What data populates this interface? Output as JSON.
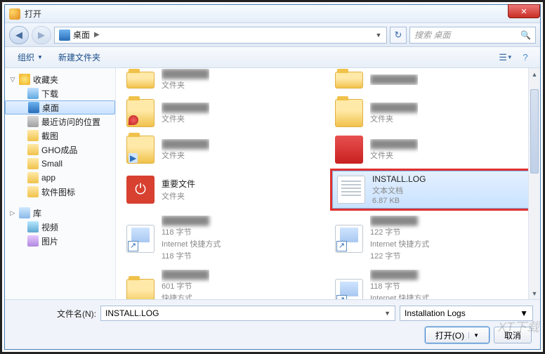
{
  "title": "打开",
  "breadcrumb": {
    "location": "桌面"
  },
  "search": {
    "placeholder": "搜索 桌面"
  },
  "toolbar": {
    "organize": "组织",
    "new_folder": "新建文件夹"
  },
  "sidebar": {
    "favorites": {
      "label": "收藏夹",
      "items": [
        {
          "label": "下载"
        },
        {
          "label": "桌面",
          "selected": true
        },
        {
          "label": "最近访问的位置"
        },
        {
          "label": "截图"
        },
        {
          "label": "GHO成品"
        },
        {
          "label": "Small"
        },
        {
          "label": "app"
        },
        {
          "label": "软件图标"
        }
      ]
    },
    "libraries": {
      "label": "库",
      "items": [
        {
          "label": "视频"
        },
        {
          "label": "图片"
        }
      ]
    }
  },
  "files": [
    {
      "name": "",
      "type": "文件夹",
      "icon": "folder",
      "col": 0,
      "blur": true
    },
    {
      "name": "",
      "type": "",
      "icon": "folder",
      "col": 1,
      "blur": true
    },
    {
      "name": "",
      "type": "文件夹",
      "icon": "folder-shield",
      "col": 0,
      "blur": true
    },
    {
      "name": "",
      "type": "文件夹",
      "icon": "folder",
      "col": 1,
      "blur": true
    },
    {
      "name": "",
      "type": "文件夹",
      "icon": "folder-arrow",
      "col": 0,
      "blur": true
    },
    {
      "name": "",
      "type": "文件夹",
      "icon": "red",
      "col": 1,
      "blur": true
    },
    {
      "name": "重要文件",
      "type": "文件夹",
      "icon": "power",
      "col": 0
    },
    {
      "name": "INSTALL.LOG",
      "type": "文本文档",
      "size": "6.87 KB",
      "icon": "doc",
      "col": 1,
      "selected": true,
      "highlighted": true
    },
    {
      "name": "Internet 快捷方式",
      "type": "118 字节",
      "icon": "short",
      "col": 0,
      "blur_name": true
    },
    {
      "name": "Internet 快捷方式",
      "type": "122 字节",
      "icon": "short",
      "col": 1,
      "blur_name": true
    },
    {
      "name": "快捷方式",
      "type": "601 字节",
      "icon": "folder",
      "col": 0,
      "blur_name": true
    },
    {
      "name": "Internet 快捷方式",
      "type": "118 字节",
      "icon": "short",
      "col": 1,
      "blur_name": true
    }
  ],
  "footer": {
    "filename_label": "文件名(N):",
    "filename_value": "INSTALL.LOG",
    "filter": "Installation Logs",
    "open": "打开(O)",
    "cancel": "取消"
  },
  "watermark": "XT下载"
}
